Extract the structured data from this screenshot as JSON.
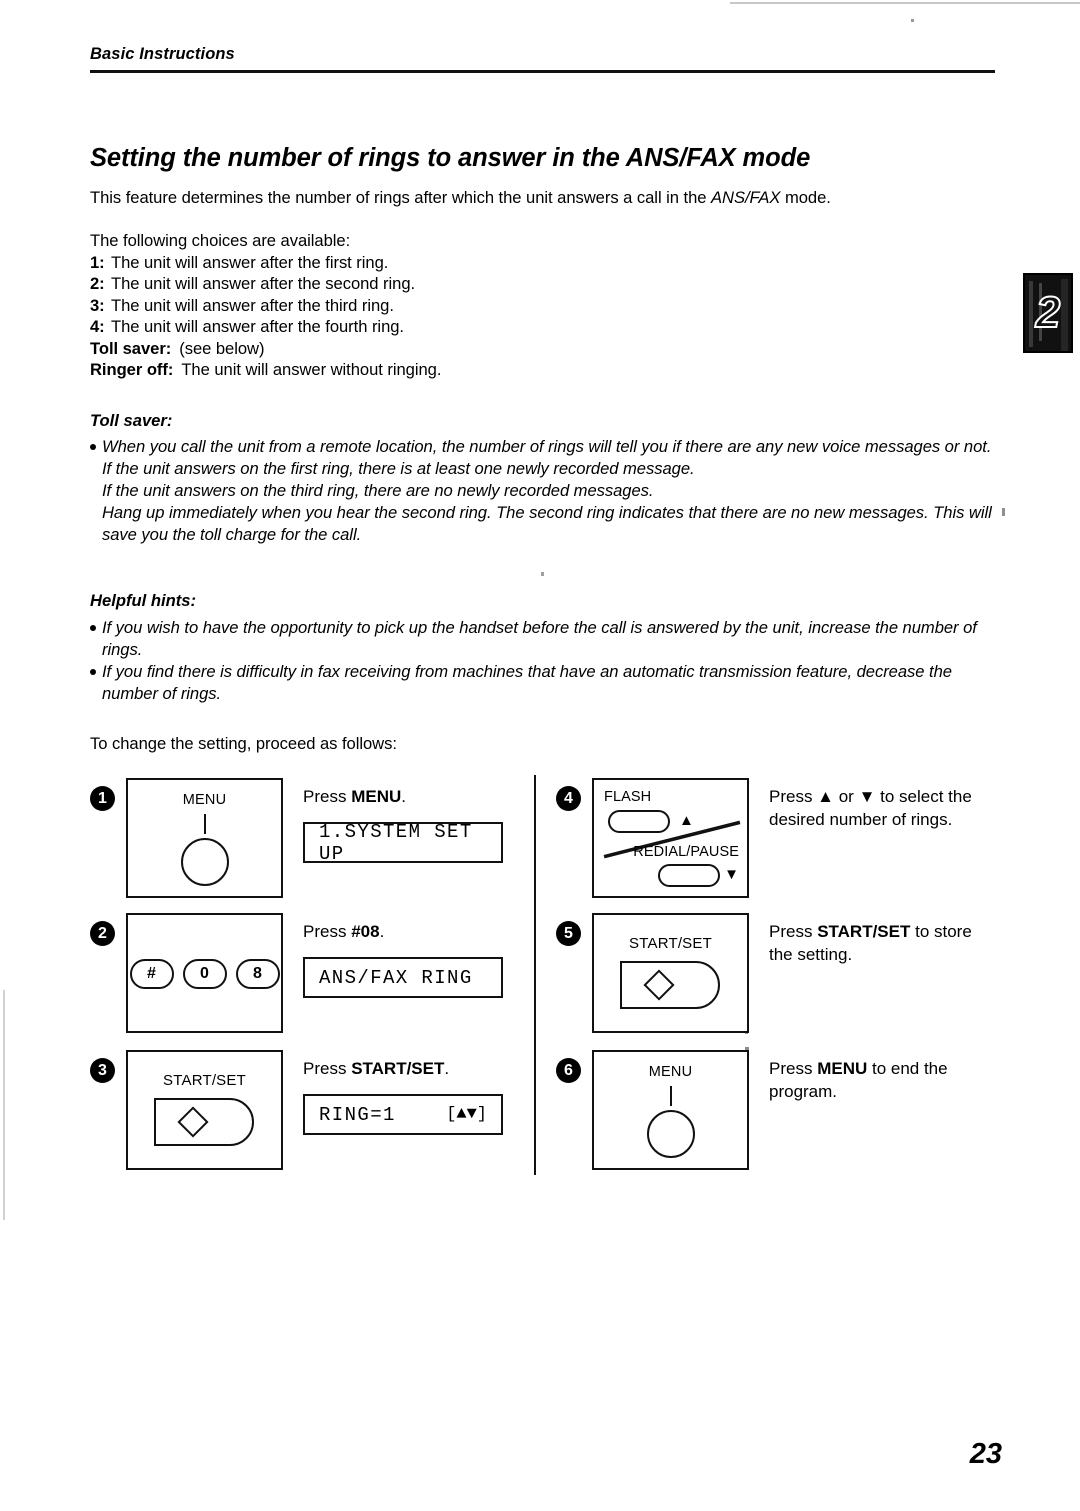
{
  "header": {
    "running_head": "Basic Instructions",
    "chapter_tab_number": "2"
  },
  "headline": "Setting the number of rings to answer in the ANS/FAX mode",
  "intro": {
    "part1": "This feature determines the number of rings after which the unit answers a call in the ",
    "emphasis": "ANS/FAX",
    "part2": " mode."
  },
  "choices": {
    "lead_in": "The following choices are available:",
    "items": [
      {
        "key": "1:",
        "text": "The unit will answer after the first ring."
      },
      {
        "key": "2:",
        "text": "The unit will answer after the second ring."
      },
      {
        "key": "3:",
        "text": "The unit will answer after the third ring."
      },
      {
        "key": "4:",
        "text": "The unit will answer after the fourth ring."
      },
      {
        "key": "Toll saver:",
        "text": "(see below)"
      },
      {
        "key": "Ringer off:",
        "text": "The unit will answer without ringing."
      }
    ]
  },
  "toll_saver": {
    "heading": "Toll saver:",
    "bullet": "When you call the unit from a remote location, the number of rings will tell you if there are any new voice messages or not.",
    "lines": [
      "If the unit answers on the first ring, there is at least one newly recorded message.",
      "If the unit answers on the third ring, there are no newly recorded messages.",
      "Hang up immediately when you hear the second ring. The second ring indicates that there are no new messages. This will save you the toll charge for the call."
    ]
  },
  "helpful_hints": {
    "heading": "Helpful hints:",
    "bullets": [
      "If you wish to have the opportunity to pick up the handset before the call is answered by the unit, increase the number of rings.",
      "If you find there is difficulty in fax receiving from machines that have an automatic transmission feature, decrease the number of rings."
    ]
  },
  "proceed_line": "To change the setting, proceed as follows:",
  "steps": [
    {
      "number": "1",
      "panel_type": "menu-key",
      "panel_label": "MENU",
      "caption_pre": "Press ",
      "caption_bold": "MENU",
      "caption_post": ".",
      "lcd": "1.SYSTEM SET UP"
    },
    {
      "number": "2",
      "panel_type": "keypad",
      "keys": [
        "#",
        "0",
        "8"
      ],
      "caption_pre": "Press ",
      "caption_bold": "#08",
      "caption_post": ".",
      "lcd": "ANS/FAX RING"
    },
    {
      "number": "3",
      "panel_type": "start-set",
      "panel_label": "START/SET",
      "caption_pre": "Press ",
      "caption_bold": "START/SET",
      "caption_post": ".",
      "lcd_left": "RING=1",
      "lcd_right": "[▲▼]"
    },
    {
      "number": "4",
      "panel_type": "flash-redial",
      "flash_label": "FLASH",
      "redial_label": "REDIAL/PAUSE",
      "up_arrow": "▲",
      "down_arrow": "▼",
      "caption": "Press ▲ or ▼ to select the desired number of rings."
    },
    {
      "number": "5",
      "panel_type": "start-set",
      "panel_label": "START/SET",
      "caption_pre": "Press ",
      "caption_bold": "START/SET",
      "caption_post": " to store the setting."
    },
    {
      "number": "6",
      "panel_type": "menu-key",
      "panel_label": "MENU",
      "caption_pre": "Press ",
      "caption_bold": "MENU",
      "caption_post": " to end the program."
    }
  ],
  "folio": "23"
}
